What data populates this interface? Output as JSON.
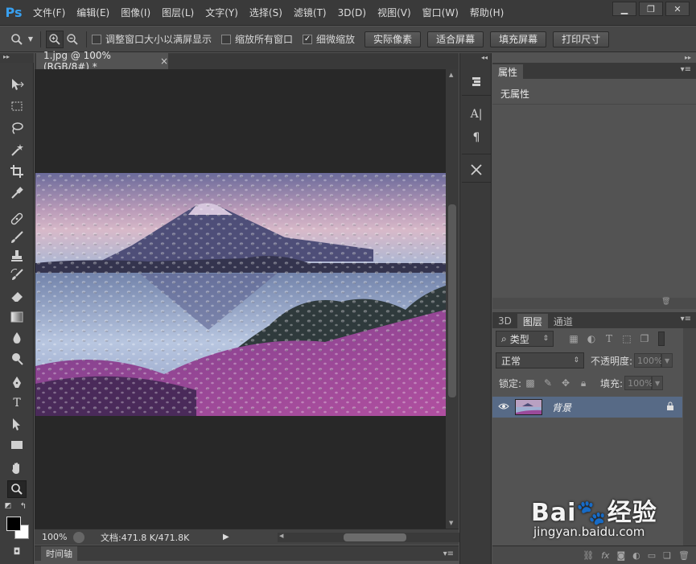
{
  "app": {
    "logo": "Ps"
  },
  "menu": [
    {
      "label": "文件(F)"
    },
    {
      "label": "编辑(E)"
    },
    {
      "label": "图像(I)"
    },
    {
      "label": "图层(L)"
    },
    {
      "label": "文字(Y)"
    },
    {
      "label": "选择(S)"
    },
    {
      "label": "滤镜(T)"
    },
    {
      "label": "3D(D)"
    },
    {
      "label": "视图(V)"
    },
    {
      "label": "窗口(W)"
    },
    {
      "label": "帮助(H)"
    }
  ],
  "window_controls": {
    "minimize": "▁",
    "restore": "❐",
    "close": "✕"
  },
  "options": {
    "resize_windows": "调整窗口大小以满屏显示",
    "zoom_all": "缩放所有窗口",
    "scrubby_zoom": "细微缩放",
    "actual_pixels": "实际像素",
    "fit_screen": "适合屏幕",
    "fill_screen": "填充屏幕",
    "print_size": "打印尺寸",
    "resize_checked": false,
    "zoom_all_checked": false,
    "scrubby_checked": true
  },
  "document": {
    "tab_title": "1.jpg @ 100%(RGB/8#) *",
    "close_glyph": "×",
    "zoom": "100%",
    "doc_size": "文档:471.8 K/471.8K"
  },
  "timeline": {
    "label": "时间轴"
  },
  "properties": {
    "tab": "属性",
    "empty_text": "无属性"
  },
  "layers": {
    "tabs": [
      "3D",
      "图层",
      "通道"
    ],
    "active_tab": "图层",
    "filter_label": "类型",
    "blend_mode": "正常",
    "opacity_label": "不透明度:",
    "opacity_value": "100%",
    "lock_label": "锁定:",
    "fill_label": "填充:",
    "fill_value": "100%",
    "items": [
      {
        "name": "背景",
        "visible": true,
        "locked": true
      }
    ]
  },
  "watermark": {
    "brand": "Bai🐾经验",
    "url": "jingyan.baidu.com"
  },
  "colors": {
    "foreground": "#000000",
    "background": "#ffffff",
    "selected_layer": "#576a86",
    "ps_blue": "#38a0f0"
  }
}
